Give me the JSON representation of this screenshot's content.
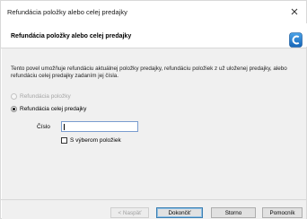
{
  "window": {
    "title": "Refundácia položky alebo celej predajky"
  },
  "header": {
    "title": "Refundácia položky alebo celej predajky"
  },
  "description": "Tento povel umožňuje refundáciu aktuálnej položky predajky, refundáciu položiek z už uloženej predajky, alebo refundáciu celej predajky zadaním jej čísla.",
  "options": {
    "item_label": "Refundácia položky",
    "item_selected": false,
    "item_enabled": false,
    "whole_label": "Refundácia celej predajky",
    "whole_selected": true
  },
  "number_field": {
    "label": "Číslo",
    "value": ""
  },
  "with_items": {
    "label": "S výberom položiek",
    "checked": false
  },
  "buttons": {
    "back": "< Naspäť",
    "finish": "Dokončiť",
    "cancel": "Storno",
    "help": "Pomocník"
  }
}
